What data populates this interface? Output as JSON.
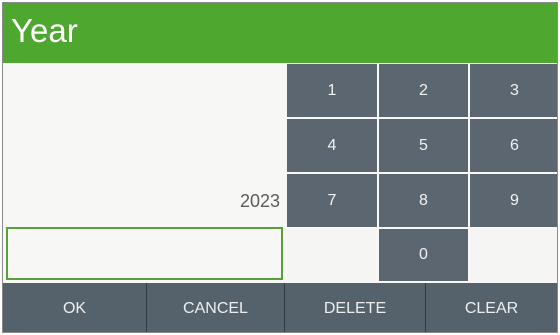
{
  "dialog": {
    "title": "Year",
    "display_value": "2023",
    "entry_value": ""
  },
  "keypad": {
    "keys": [
      "1",
      "2",
      "3",
      "4",
      "5",
      "6",
      "7",
      "8",
      "9",
      "",
      "0",
      ""
    ]
  },
  "actions": {
    "ok_label": "OK",
    "cancel_label": "CANCEL",
    "delete_label": "DELETE",
    "clear_label": "CLEAR"
  },
  "colors": {
    "title_bar": "#4ea72e",
    "key_bg": "#5b6670",
    "bottom_bar": "#56626b",
    "entry_border": "#5aa03a"
  }
}
